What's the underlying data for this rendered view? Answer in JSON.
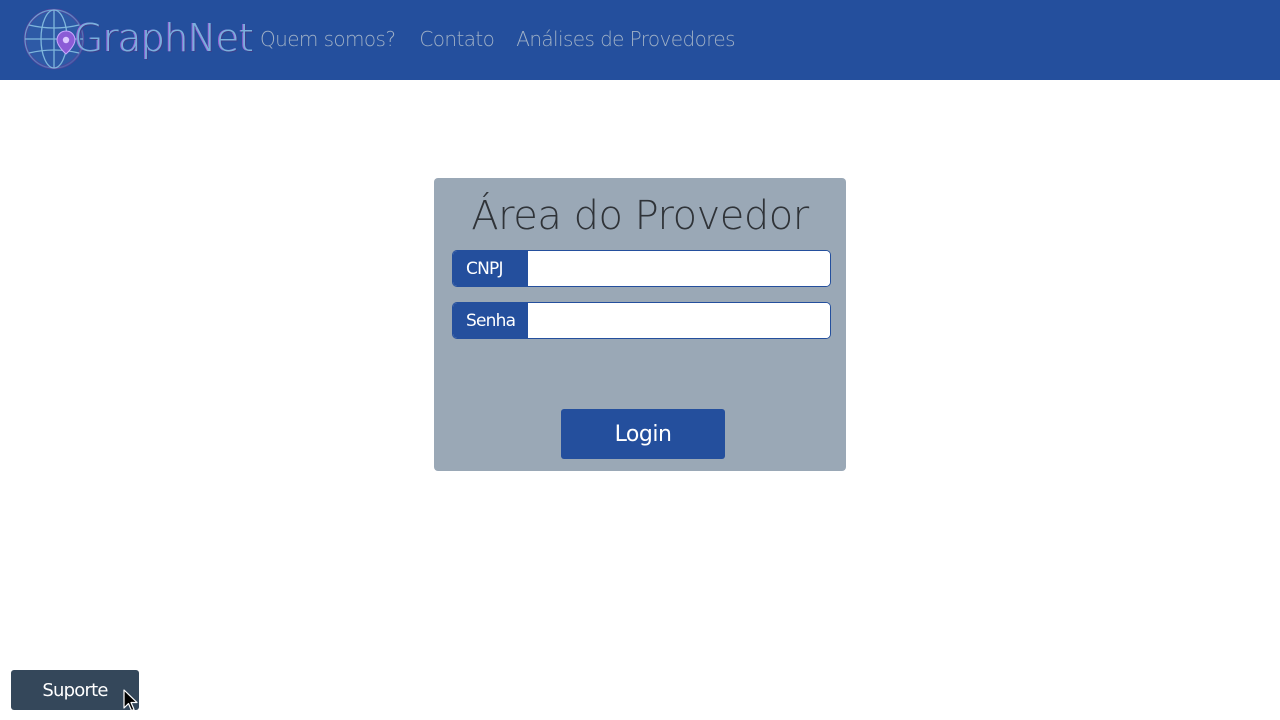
{
  "brand": {
    "name": "GraphNet",
    "primary_color": "#244f9d"
  },
  "nav": {
    "links": [
      {
        "label": "Quem somos?"
      },
      {
        "label": "Contato"
      },
      {
        "label": "Análises de Provedores"
      }
    ]
  },
  "login": {
    "title": "Área do Provedor",
    "fields": {
      "cnpj": {
        "label": "CNPJ",
        "value": "",
        "placeholder": ""
      },
      "senha": {
        "label": "Senha",
        "value": "",
        "placeholder": ""
      }
    },
    "submit_label": "Login",
    "card_color": "#9aa8b6"
  },
  "support": {
    "label": "Suporte",
    "color": "#34475a"
  },
  "icons": {
    "logo": "globe-pin-icon",
    "cursor": "mouse-pointer-icon"
  }
}
